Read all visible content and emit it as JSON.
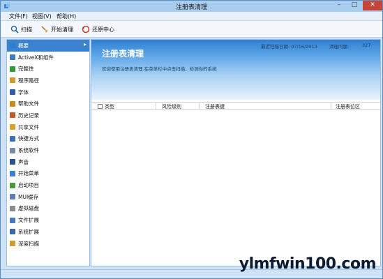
{
  "window": {
    "title": "注册表清理"
  },
  "menu": {
    "file": "文件(F)",
    "view": "视图(V)",
    "help": "帮助(H)"
  },
  "toolbar": {
    "scan": "扫描",
    "clean": "开始清理",
    "restore": "还原中心"
  },
  "sidebar": {
    "items": [
      {
        "label": "概要",
        "icon": "overview-icon",
        "color": "#2f7fd1"
      },
      {
        "label": "ActiveX和组件",
        "icon": "activex-icon",
        "color": "#3a7bc8"
      },
      {
        "label": "完整性",
        "icon": "integrity-icon",
        "color": "#2e9a3a"
      },
      {
        "label": "程序路径",
        "icon": "program-path-icon",
        "color": "#d49b2a"
      },
      {
        "label": "字体",
        "icon": "font-icon",
        "color": "#2a5ea8"
      },
      {
        "label": "帮助文件",
        "icon": "help-file-icon",
        "color": "#c98a18"
      },
      {
        "label": "历史记录",
        "icon": "history-icon",
        "color": "#c55a28"
      },
      {
        "label": "共享文件",
        "icon": "shared-file-icon",
        "color": "#d9a12a"
      },
      {
        "label": "快捷方式",
        "icon": "shortcut-icon",
        "color": "#3b6fb8"
      },
      {
        "label": "系统软件",
        "icon": "system-software-icon",
        "color": "#7a8aa0"
      },
      {
        "label": "声音",
        "icon": "sound-icon",
        "color": "#2b4f8a"
      },
      {
        "label": "开始菜单",
        "icon": "start-menu-icon",
        "color": "#3c7fcf"
      },
      {
        "label": "启动项目",
        "icon": "startup-icon",
        "color": "#4a9a3a"
      },
      {
        "label": "MUI缓存",
        "icon": "mui-cache-icon",
        "color": "#5a7fb0"
      },
      {
        "label": "虚拟磁盘",
        "icon": "virtual-disk-icon",
        "color": "#8a8a8a"
      },
      {
        "label": "文件扩展",
        "icon": "file-extension-icon",
        "color": "#4a78b8"
      },
      {
        "label": "系统扩展",
        "icon": "system-extension-icon",
        "color": "#3a66a8"
      },
      {
        "label": "深度扫描",
        "icon": "deep-scan-icon",
        "color": "#d09a30"
      }
    ]
  },
  "main": {
    "heading": "注册表清理",
    "description": "欢迎使用注册表清理.在菜单栏中点击扫描，检测你的系统",
    "last_scan_label": "最近扫描日期: 07/16/2013",
    "issues_label": "清理问题:",
    "issues_count": "327",
    "columns": [
      "类型",
      "风险级别",
      "注册表键",
      "注册表位区"
    ]
  },
  "watermark": "ylmfwin100.com",
  "colors": {
    "accent": "#3c83cf",
    "close_button": "#c7443b"
  }
}
